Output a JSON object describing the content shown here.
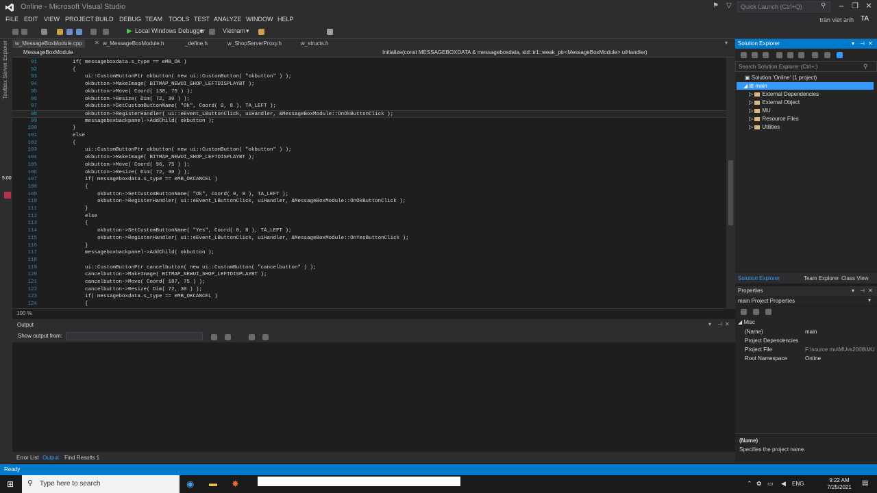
{
  "window": {
    "title": "Online - Microsoft Visual Studio",
    "quick_launch": "Quick Launch (Ctrl+Q)",
    "user": "tran viet anh",
    "avatar": "TA"
  },
  "menu": [
    "FILE",
    "EDIT",
    "VIEW",
    "PROJECT",
    "BUILD",
    "DEBUG",
    "TEAM",
    "TOOLS",
    "TEST",
    "ANALYZE",
    "WINDOW",
    "HELP"
  ],
  "toolbar": {
    "debugger": "Local Windows Debugger",
    "config": "Vietnam"
  },
  "left_strip": [
    "Server Explorer",
    "Toolbox"
  ],
  "tabs": [
    "w_MessageBoxModule.cpp",
    "w_MessageBoxModule.h",
    "_define.h",
    "w_ShopServerProxy.h",
    "w_structs.h"
  ],
  "nav": {
    "left": "MessageBoxModule",
    "right": "Initialize(const MESSAGEBOXDATA & messageboxdata, std::tr1::weak_ptr<MessageBoxModule> uiHandler)"
  },
  "code": [
    {
      "n": "91",
      "t": "    if( messageboxdata.s_type == eMB_OK )"
    },
    {
      "n": "92",
      "t": "    {"
    },
    {
      "n": "93",
      "t": "        ui::CustomButtonPtr okbutton( new ui::CustomButton( \"okbutton\" ) );"
    },
    {
      "n": "94",
      "t": "        okbutton->MakeImage( BITMAP_NEWUI_SHOP_LEFTDISPLAYBT );"
    },
    {
      "n": "95",
      "t": "        okbutton->Move( Coord( 138, 75 ) );"
    },
    {
      "n": "96",
      "t": "        okbutton->Resize( Dim( 72, 30 ) );"
    },
    {
      "n": "97",
      "t": "        okbutton->SetCustomButtonName( \"Ok\", Coord( 0, 8 ), TA_LEFT );"
    },
    {
      "n": "98",
      "t": "        okbutton->RegisterHandler( ui::eEvent_LButtonClick, uiHandler, &MessageBoxModule::OnOkButtonClick );"
    },
    {
      "n": "99",
      "t": "        messageboxbackpanel->AddChild( okbutton );"
    },
    {
      "n": "100",
      "t": "    }"
    },
    {
      "n": "101",
      "t": "    else"
    },
    {
      "n": "102",
      "t": "    {"
    },
    {
      "n": "103",
      "t": "        ui::CustomButtonPtr okbutton( new ui::CustomButton( \"okbutton\" ) );"
    },
    {
      "n": "104",
      "t": "        okbutton->MakeImage( BITMAP_NEWUI_SHOP_LEFTDISPLAYBT );"
    },
    {
      "n": "105",
      "t": "        okbutton->Move( Coord( 96, 75 ) );"
    },
    {
      "n": "106",
      "t": "        okbutton->Resize( Dim( 72, 30 ) );"
    },
    {
      "n": "107",
      "t": "        if( messageboxdata.s_type == eMB_OKCANCEL )"
    },
    {
      "n": "108",
      "t": "        {"
    },
    {
      "n": "109",
      "t": "            okbutton->SetCustomButtonName( \"Ok\", Coord( 0, 8 ), TA_LEFT );"
    },
    {
      "n": "110",
      "t": "            okbutton->RegisterHandler( ui::eEvent_LButtonClick, uiHandler, &MessageBoxModule::OnOkButtonClick );"
    },
    {
      "n": "111",
      "t": "        }"
    },
    {
      "n": "112",
      "t": "        else"
    },
    {
      "n": "113",
      "t": "        {"
    },
    {
      "n": "114",
      "t": "            okbutton->SetCustomButtonName( \"Yes\", Coord( 0, 8 ), TA_LEFT );"
    },
    {
      "n": "115",
      "t": "            okbutton->RegisterHandler( ui::eEvent_LButtonClick, uiHandler, &MessageBoxModule::OnYesButtonClick );"
    },
    {
      "n": "116",
      "t": "        }"
    },
    {
      "n": "117",
      "t": "        messageboxbackpanel->AddChild( okbutton );"
    },
    {
      "n": "118",
      "t": ""
    },
    {
      "n": "119",
      "t": "        ui::CustomButtonPtr cancelbutton( new ui::CustomButton( \"cancelbutton\" ) );"
    },
    {
      "n": "120",
      "t": "        cancelbutton->MakeImage( BITMAP_NEWUI_SHOP_LEFTDISPLAYBT );"
    },
    {
      "n": "121",
      "t": "        cancelbutton->Move( Coord( 187, 75 ) );"
    },
    {
      "n": "122",
      "t": "        cancelbutton->Resize( Dim( 72, 30 ) );"
    },
    {
      "n": "123",
      "t": "        if( messageboxdata.s_type == eMB_OKCANCEL )"
    },
    {
      "n": "124",
      "t": "        {"
    }
  ],
  "zoom": "100 %",
  "output": {
    "title": "Output",
    "show_from": "Show output from:"
  },
  "bottom_tabs": [
    "Error List",
    "Output",
    "Find Results 1"
  ],
  "solution_explorer": {
    "title": "Solution Explorer",
    "search": "Search Solution Explorer (Ctrl+;)",
    "solution": "Solution 'Online' (1 project)",
    "project": "main",
    "folders": [
      "External Dependencies",
      "External Object",
      "MU",
      "Resource Files",
      "Utilities"
    ],
    "tabs": [
      "Solution Explorer",
      "Team Explorer",
      "Class View"
    ]
  },
  "properties": {
    "title": "Properties",
    "object": "main Project Properties",
    "category": "Misc",
    "rows": [
      {
        "k": "(Name)",
        "v": "main"
      },
      {
        "k": "Project Dependencies",
        "v": ""
      },
      {
        "k": "Project File",
        "v": "F:\\source mu\\MUvs2008\\MU"
      },
      {
        "k": "Root Namespace",
        "v": "Online"
      }
    ],
    "desc_name": "(Name)",
    "desc_text": "Specifies the project name."
  },
  "status": "Ready",
  "taskbar": {
    "search": "Type here to search",
    "lang": "ENG",
    "time": "9:22 AM",
    "date": "7/25/2021"
  },
  "colors": {
    "accent": "#007acc",
    "selection": "#3399ff"
  }
}
